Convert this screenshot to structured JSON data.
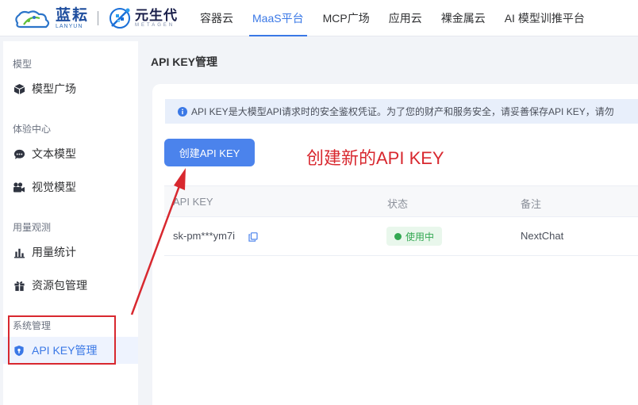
{
  "brand": {
    "lanyun_cn": "蓝耘",
    "lanyun_en": "LANYUN",
    "metagen_cn": "元生代",
    "metagen_en": "METAGEN"
  },
  "nav": {
    "items": [
      {
        "label": "容器云"
      },
      {
        "label": "MaaS平台",
        "active": true
      },
      {
        "label": "MCP广场"
      },
      {
        "label": "应用云"
      },
      {
        "label": "裸金属云"
      },
      {
        "label": "AI 模型训推平台"
      }
    ]
  },
  "sidebar": {
    "groups": [
      {
        "label": "模型"
      },
      {
        "label": "体验中心"
      },
      {
        "label": "用量观测"
      },
      {
        "label": "系统管理"
      }
    ],
    "items": [
      {
        "label": "模型广场",
        "icon": "cube-icon"
      },
      {
        "label": "文本模型",
        "icon": "chat-icon"
      },
      {
        "label": "视觉模型",
        "icon": "camera-icon"
      },
      {
        "label": "用量统计",
        "icon": "bar-chart-icon"
      },
      {
        "label": "资源包管理",
        "icon": "gift-icon"
      },
      {
        "label": "API KEY管理",
        "icon": "shield-icon",
        "active": true
      }
    ]
  },
  "main": {
    "page_title": "API KEY管理",
    "alert_text": "API KEY是大模型API请求时的安全鉴权凭证。为了您的财产和服务安全，请妥善保存API KEY，请勿",
    "create_button": "创建API KEY",
    "annotation": "创建新的API KEY",
    "table": {
      "columns": [
        "API KEY",
        "状态",
        "备注"
      ],
      "rows": [
        {
          "api_key": "sk-pm***ym7i",
          "status": "使用中",
          "note": "NextChat"
        }
      ]
    }
  },
  "colors": {
    "accent": "#3a78e6",
    "button": "#4b83ec",
    "annotation_red": "#d8282f",
    "status_green": "#33a852"
  }
}
